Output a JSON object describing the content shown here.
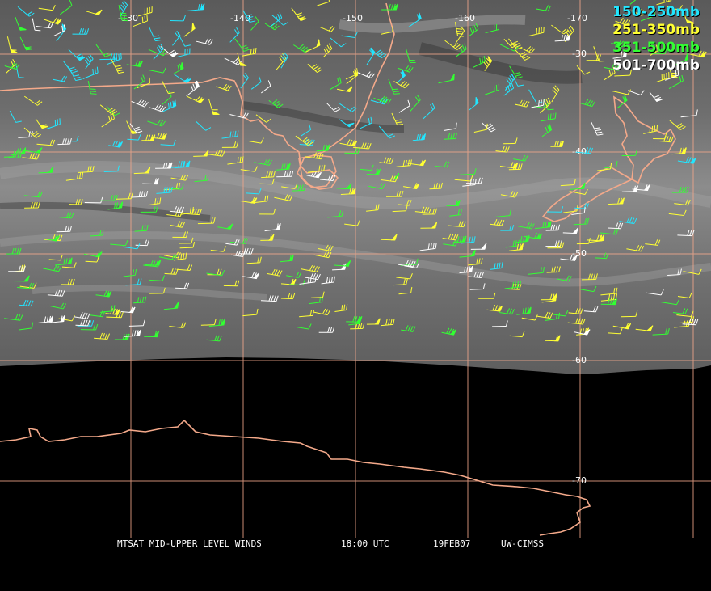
{
  "legend": [
    {
      "label": "150-250mb",
      "color": "#22e6ff"
    },
    {
      "label": "251-350mb",
      "color": "#ffff33"
    },
    {
      "label": "351-500mb",
      "color": "#33ff33"
    },
    {
      "label": "501-700mb",
      "color": "#ffffff"
    }
  ],
  "longitude_labels": [
    "-130",
    "-140",
    "-150",
    "-160",
    "-170"
  ],
  "latitude_labels": [
    "-30",
    "-40",
    "-50",
    "-60",
    "-70"
  ],
  "footer": {
    "product": "MTSAT MID-UPPER LEVEL WINDS",
    "time": "18:00 UTC",
    "date": "19FEB07",
    "source": "UW-CIMSS"
  },
  "colors": {
    "grid": "#f0a68a",
    "coastline": "#f4a98a",
    "imagery_dark": "#3a3a3a",
    "imagery_light": "#9a9a9a",
    "no_data": "#000000"
  }
}
